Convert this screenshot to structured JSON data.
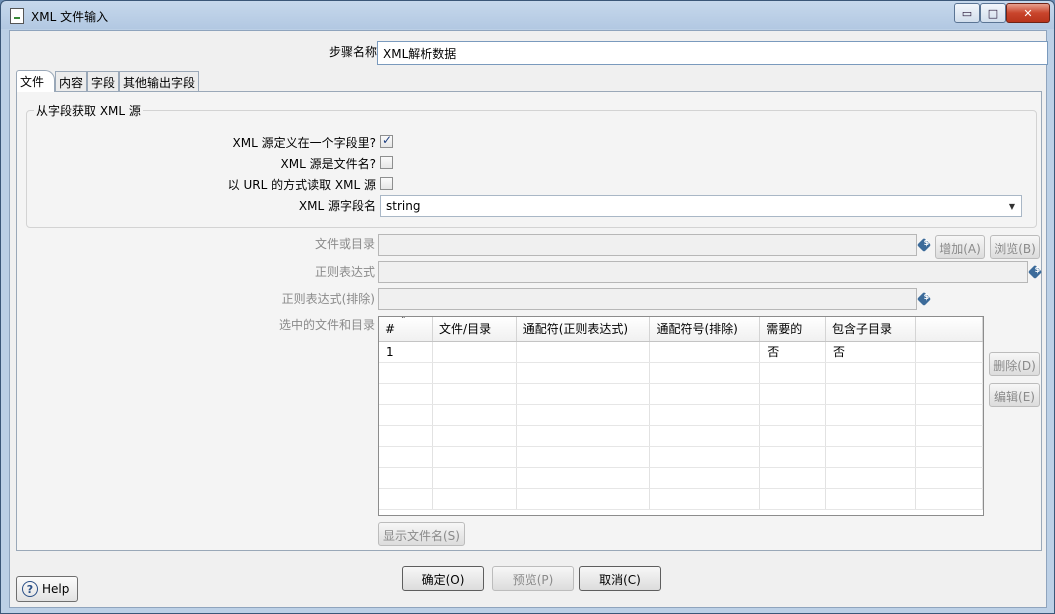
{
  "window": {
    "title": "XML 文件输入",
    "controls": {
      "min": "▭",
      "max": "□",
      "close": "✕"
    }
  },
  "step": {
    "label": "步骤名称",
    "value": "XML解析数据"
  },
  "tabs": [
    {
      "label": "文件",
      "active": true
    },
    {
      "label": "内容",
      "active": false
    },
    {
      "label": "字段",
      "active": false
    },
    {
      "label": "其他输出字段",
      "active": false
    }
  ],
  "source_group": {
    "title": "从字段获取 XML 源",
    "xml_in_field": {
      "label": "XML 源定义在一个字段里?",
      "checked": true
    },
    "xml_is_filename": {
      "label": "XML 源是文件名?",
      "checked": false
    },
    "read_as_url": {
      "label": "以 URL 的方式读取 XML 源",
      "checked": false
    },
    "source_field": {
      "label": "XML 源字段名",
      "value": "string"
    }
  },
  "file_section": {
    "file_or_dir_label": "文件或目录",
    "regex_label": "正则表达式",
    "regex_exclude_label": "正则表达式(排除)",
    "selected_files_label": "选中的文件和目录",
    "add_button": "增加(A)",
    "browse_button": "浏览(B)",
    "delete_button": "删除(D)",
    "edit_button": "编辑(E)",
    "show_filenames_button": "显示文件名(S)",
    "var_icon": "$"
  },
  "grid": {
    "columns": [
      "#",
      "文件/目录",
      "通配符(正则表达式)",
      "通配符号(排除)",
      "需要的",
      "包含子目录"
    ],
    "rows": [
      [
        "1",
        "",
        "",
        "",
        "否",
        "否"
      ]
    ]
  },
  "footer": {
    "help": "Help",
    "ok": "确定(O)",
    "preview": "预览(P)",
    "cancel": "取消(C)"
  }
}
